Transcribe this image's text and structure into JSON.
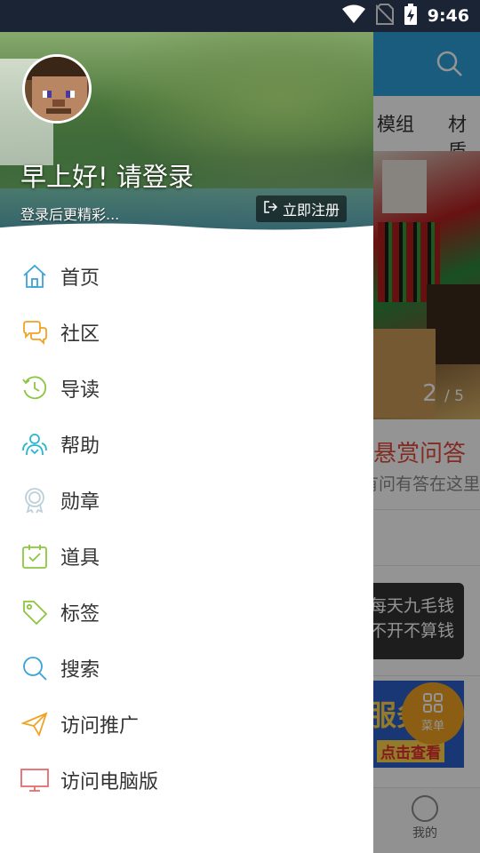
{
  "status_bar": {
    "time": "9:46",
    "icons": [
      "wifi-icon",
      "no-sim-icon",
      "battery-charging-icon"
    ]
  },
  "drawer": {
    "greeting": "早上好! 请登录",
    "login_hint": "登录后更精彩...",
    "register_label": "立即注册",
    "menu": [
      {
        "label": "首页",
        "icon": "home-icon",
        "color": "#3aa3d9"
      },
      {
        "label": "社区",
        "icon": "chat-icon",
        "color": "#f0a322"
      },
      {
        "label": "导读",
        "icon": "history-icon",
        "color": "#8cc63f"
      },
      {
        "label": "帮助",
        "icon": "help-people-icon",
        "color": "#29b6d1"
      },
      {
        "label": "勋章",
        "icon": "medal-icon",
        "color": "#bcd0dc"
      },
      {
        "label": "道具",
        "icon": "calendar-check-icon",
        "color": "#8cc63f"
      },
      {
        "label": "标签",
        "icon": "tag-icon",
        "color": "#8cc63f"
      },
      {
        "label": "搜索",
        "icon": "search-icon",
        "color": "#3aa3d9"
      },
      {
        "label": "访问推广",
        "icon": "paper-plane-icon",
        "color": "#f0a322"
      },
      {
        "label": "访问电脑版",
        "icon": "desktop-icon",
        "color": "#e86a6a"
      }
    ]
  },
  "background_app": {
    "tabs": [
      "模组",
      "材质"
    ],
    "banner_counter": {
      "current": "2",
      "total": "/ 5"
    },
    "qa_title": "悬赏问答",
    "qa_subtitle": "有问有答在这里",
    "tip_lines": [
      "每天九毛钱",
      "不开不算钱"
    ],
    "ad_text": "服务",
    "ad_cta": "点击查看",
    "fab_label": "菜单",
    "bottom_tab": "我的"
  }
}
